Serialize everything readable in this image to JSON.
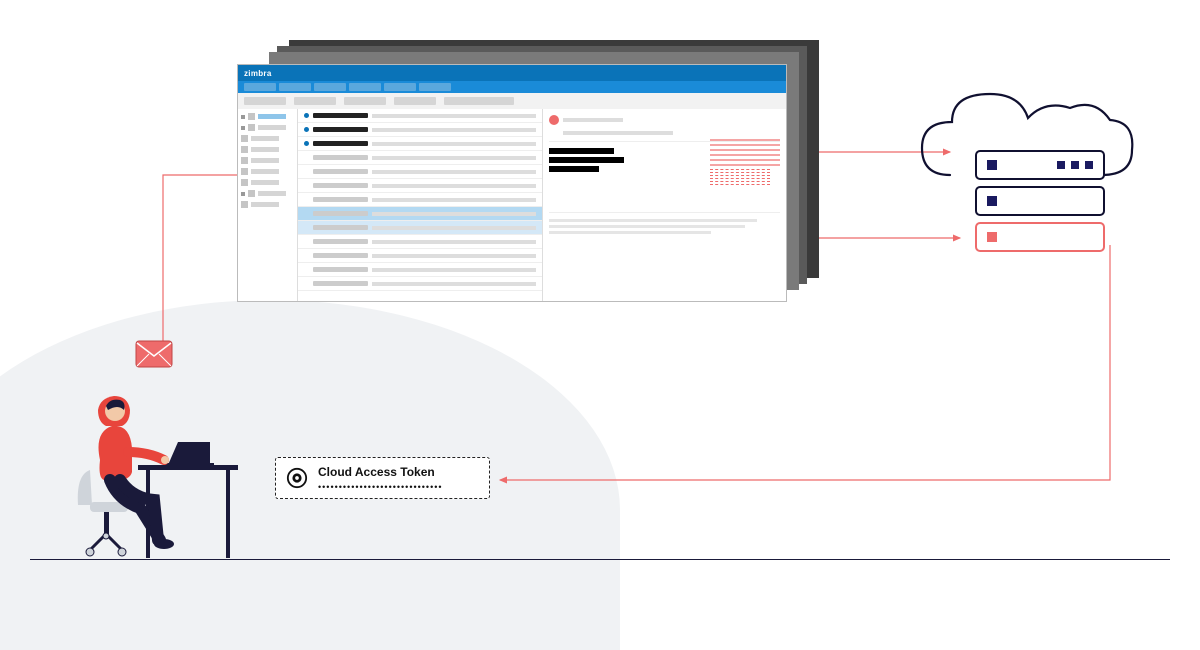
{
  "diagram": {
    "app_name": "zimbra",
    "token_label": "Cloud Access Token",
    "token_masked": "••••••••••••••••••••••••••••••",
    "flow_sequence": [
      "user-sends-email",
      "email-enters-zimbra-ui",
      "zimbra-session-to-cloud-server",
      "server-issues-cloud-access-token",
      "token-returns-toward-user"
    ],
    "colors": {
      "accent_blue": "#0a73b8",
      "attack_red": "#ee6b6b",
      "server_navy": "#1a1a60"
    },
    "cloud": {
      "server_units": 3,
      "compromised_unit_index": 2
    }
  }
}
